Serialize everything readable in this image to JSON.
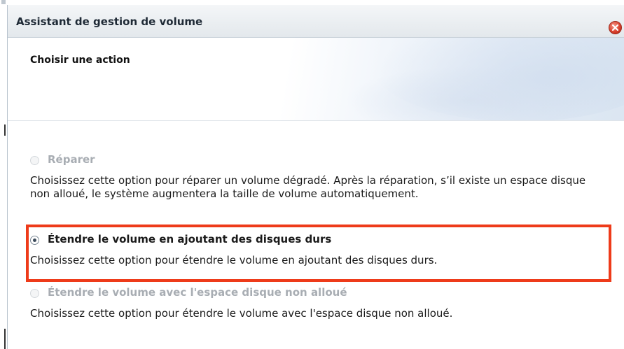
{
  "window": {
    "title": "Assistant de gestion de volume"
  },
  "header": {
    "title": "Choisir une action"
  },
  "options": [
    {
      "label": "Réparer",
      "state": "disabled",
      "description": "Choisissez cette option pour réparer un volume dégradé. Après la réparation, s’il existe un espace disque non alloué, le système augmentera la taille de volume automatiquement."
    },
    {
      "label": "Étendre le volume en ajoutant des disques durs",
      "state": "selected",
      "description": "Choisissez cette option pour étendre le volume en ajoutant des disques durs."
    },
    {
      "label": "Étendre le volume avec l'espace disque non alloué",
      "state": "disabled",
      "description": "Choisissez cette option pour étendre le volume avec l'espace disque non alloué."
    }
  ],
  "icons": {
    "close": "close-icon"
  },
  "colors": {
    "highlight": "#ee3b1a",
    "close_button": "#d9412e",
    "disabled_text": "#a8adb3"
  }
}
